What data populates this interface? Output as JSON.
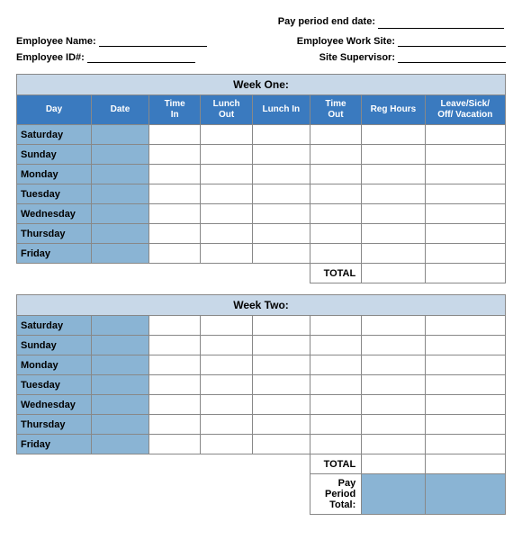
{
  "header": {
    "pay_period_label": "Pay period end date:",
    "employee_name_label": "Employee Name:",
    "employee_worksite_label": "Employee Work Site:",
    "employee_id_label": "Employee ID#:",
    "site_supervisor_label": "Site Supervisor:"
  },
  "week_one": {
    "title": "Week One:",
    "columns": [
      "Day",
      "Date",
      "Time\nIn",
      "Lunch\nOut",
      "Lunch In",
      "Time\nOut",
      "Reg Hours",
      "Leave/Sick/\nOff/ Vacation"
    ],
    "days": [
      "Saturday",
      "Sunday",
      "Monday",
      "Tuesday",
      "Wednesday",
      "Thursday",
      "Friday"
    ],
    "total_label": "TOTAL"
  },
  "week_two": {
    "title": "Week Two:",
    "days": [
      "Saturday",
      "Sunday",
      "Monday",
      "Tuesday",
      "Wednesday",
      "Thursday",
      "Friday"
    ],
    "total_label": "TOTAL"
  },
  "pay_period_total_label": "Pay Period Total:"
}
